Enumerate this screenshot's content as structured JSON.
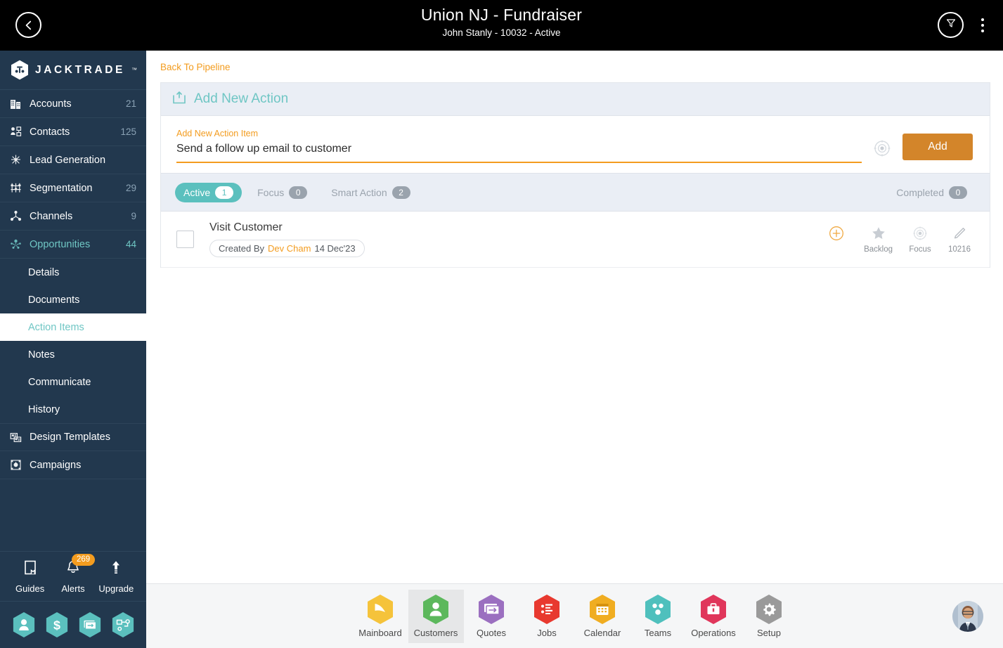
{
  "topbar": {
    "title": "Union NJ - Fundraiser",
    "subtitle": "John Stanly - 10032 - Active",
    "back_icon": "chevron-left-icon",
    "filter_icon": "filter-funnel-icon",
    "menu_icon": "kebab-menu-icon"
  },
  "sidebar": {
    "logo_text": "JACKTRADE",
    "logo_tm": "™",
    "items": [
      {
        "label": "Accounts",
        "count": "21",
        "icon": "building-icon",
        "active": false
      },
      {
        "label": "Contacts",
        "count": "125",
        "icon": "contacts-icon",
        "active": false
      },
      {
        "label": "Lead Generation",
        "count": "",
        "icon": "lead-generation-icon",
        "active": false
      },
      {
        "label": "Segmentation",
        "count": "29",
        "icon": "segmentation-icon",
        "active": false
      },
      {
        "label": "Channels",
        "count": "9",
        "icon": "channels-icon",
        "active": false
      },
      {
        "label": "Opportunities",
        "count": "44",
        "icon": "opportunities-icon",
        "active": true
      }
    ],
    "sub_items": [
      {
        "label": "Details",
        "selected": false
      },
      {
        "label": "Documents",
        "selected": false
      },
      {
        "label": "Action Items",
        "selected": true
      },
      {
        "label": "Notes",
        "selected": false
      },
      {
        "label": "Communicate",
        "selected": false
      },
      {
        "label": "History",
        "selected": false
      }
    ],
    "items_after": [
      {
        "label": "Design Templates",
        "count": "",
        "icon": "design-templates-icon",
        "active": false
      },
      {
        "label": "Campaigns",
        "count": "",
        "icon": "campaigns-icon",
        "active": false
      }
    ],
    "utilities": [
      {
        "label": "Guides",
        "icon": "book-icon",
        "badge": ""
      },
      {
        "label": "Alerts",
        "icon": "bell-icon",
        "badge": "269"
      },
      {
        "label": "Upgrade",
        "icon": "arrow-up-icon",
        "badge": ""
      }
    ],
    "quick_hex": [
      {
        "icon": "person-icon"
      },
      {
        "icon": "dollar-icon"
      },
      {
        "icon": "payment-icon"
      },
      {
        "icon": "workflow-icon"
      }
    ],
    "colors": {
      "bg": "#22384e",
      "accent": "#6fc6c4",
      "badge": "#f39c1f",
      "hex": "#5bc0be"
    }
  },
  "main": {
    "back_link": "Back To Pipeline",
    "panel_title": "Add New Action",
    "panel_icon": "add-action-icon",
    "form": {
      "label": "Add New Action Item",
      "value": "Send a follow up email to customer",
      "placeholder": "",
      "mic_icon": "voice-input-icon",
      "add_button": "Add"
    },
    "tabs": [
      {
        "label": "Active",
        "count": "1",
        "active": true
      },
      {
        "label": "Focus",
        "count": "0",
        "active": false
      },
      {
        "label": "Smart Action",
        "count": "2",
        "active": false
      }
    ],
    "tabs_right": [
      {
        "label": "Completed",
        "count": "0",
        "active": false
      }
    ],
    "rows": [
      {
        "title": "Visit Customer",
        "chip_prefix": "Created By",
        "chip_who": "Dev Cham",
        "chip_date": "14 Dec'23",
        "actions": [
          {
            "label": "",
            "icon": "plus-circle-icon"
          },
          {
            "label": "Backlog",
            "icon": "star-icon"
          },
          {
            "label": "Focus",
            "icon": "focus-target-icon"
          },
          {
            "label": "10216",
            "icon": "edit-pencil-icon"
          }
        ]
      }
    ]
  },
  "bottombar": {
    "items": [
      {
        "label": "Mainboard",
        "icon": "mainboard-icon",
        "color": "#f5c33b",
        "active": false
      },
      {
        "label": "Customers",
        "icon": "customers-icon",
        "color": "#5cb85c",
        "active": true
      },
      {
        "label": "Quotes",
        "icon": "quotes-icon",
        "color": "#9b6fc0",
        "active": false
      },
      {
        "label": "Jobs",
        "icon": "jobs-icon",
        "color": "#e8392f",
        "active": false
      },
      {
        "label": "Calendar",
        "icon": "calendar-icon",
        "color": "#f0ad21",
        "active": false
      },
      {
        "label": "Teams",
        "icon": "teams-icon",
        "color": "#4fc0bd",
        "active": false
      },
      {
        "label": "Operations",
        "icon": "operations-icon",
        "color": "#e0365b",
        "active": false
      },
      {
        "label": "Setup",
        "icon": "setup-gear-icon",
        "color": "#9a9a9a",
        "active": false
      }
    ],
    "avatar_icon": "user-avatar"
  }
}
